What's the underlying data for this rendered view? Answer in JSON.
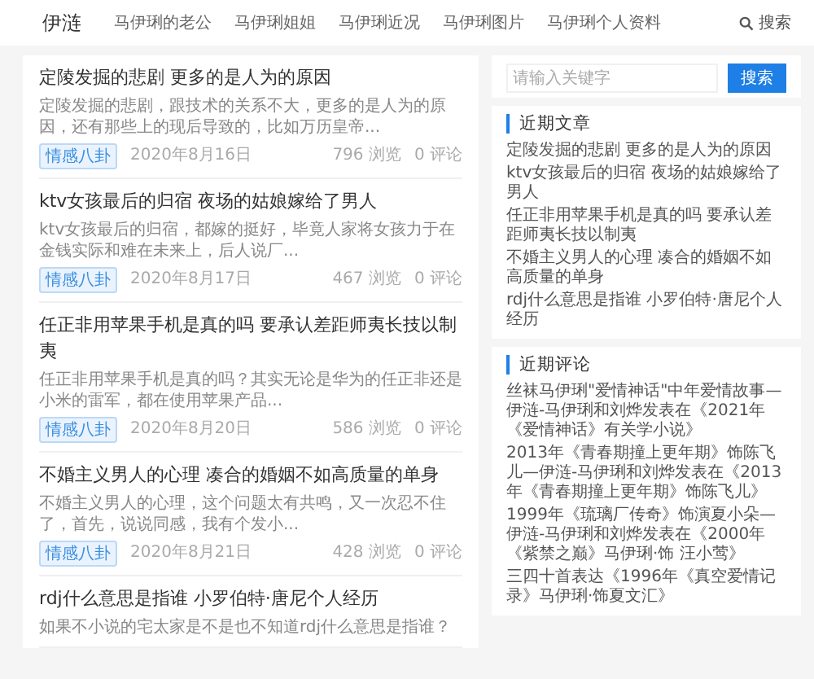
{
  "header": {
    "logo": "伊涟",
    "nav": [
      "马伊琍的老公",
      "马伊琍姐姐",
      "马伊琍近况",
      "马伊琍图片",
      "马伊琍个人资料"
    ],
    "search_link": "搜索"
  },
  "articles": [
    {
      "title": "定陵发掘的悲剧 更多的是人为的原因",
      "excerpt": "定陵发掘的悲剧，跟技术的关系不大，更多的是人为的原因，还有那些上的现后导致的，比如万历皇帝...",
      "tag": "情感八卦",
      "date": "2020年8月16日",
      "views": "796 浏览",
      "comments": "0 评论"
    },
    {
      "title": "ktv女孩最后的归宿 夜场的姑娘嫁给了男人",
      "excerpt": "ktv女孩最后的归宿，都嫁的挺好，毕竟人家将女孩力于在金钱实际和难在未来上，后人说厂...",
      "tag": "情感八卦",
      "date": "2020年8月17日",
      "views": "467 浏览",
      "comments": "0 评论"
    },
    {
      "title": "任正非用苹果手机是真的吗 要承认差距师夷长技以制夷",
      "excerpt": "任正非用苹果手机是真的吗？其实无论是华为的任正非还是小米的雷军，都在使用苹果产品...",
      "tag": "情感八卦",
      "date": "2020年8月20日",
      "views": "586 浏览",
      "comments": "0 评论"
    },
    {
      "title": "不婚主义男人的心理 凑合的婚姻不如高质量的单身",
      "excerpt": "不婚主义男人的心理，这个问题太有共鸣，又一次忍不住了，首先，说说同感，我有个发小...",
      "tag": "情感八卦",
      "date": "2020年8月21日",
      "views": "428 浏览",
      "comments": "0 评论"
    },
    {
      "title": "rdj什么意思是指谁 小罗伯特·唐尼个人经历",
      "excerpt": "如果不小说的宅太家是不是也不知道rdj什么意思是指谁？"
    }
  ],
  "sidebar": {
    "search": {
      "placeholder": "请输入关键字",
      "button": "搜索"
    },
    "recent": {
      "heading": "近期文章",
      "items": [
        "定陵发掘的悲剧 更多的是人为的原因",
        "ktv女孩最后的归宿 夜场的姑娘嫁给了男人",
        "任正非用苹果手机是真的吗 要承认差距师夷长技以制夷",
        "不婚主义男人的心理 凑合的婚姻不如高质量的单身",
        "rdj什么意思是指谁 小罗伯特·唐尼个人经历"
      ]
    },
    "comments": {
      "heading": "近期评论",
      "items": [
        "丝袜马伊琍\"爱情神话\"中年爱情故事—伊涟-马伊琍和刘烨发表在《2021年《爱情神话》有关学小说》",
        "2013年《青春期撞上更年期》饰陈飞儿—伊涟-马伊琍和刘烨发表在《2013年《青春期撞上更年期》饰陈飞儿》",
        "1999年《琉璃厂传奇》饰演夏小朵—伊涟-马伊琍和刘烨发表在《2000年《紫禁之巅》马伊琍·饰 汪小莺》",
        "三四十首表达《1996年《真空爱情记录》马伊琍·饰夏文汇》"
      ]
    }
  }
}
